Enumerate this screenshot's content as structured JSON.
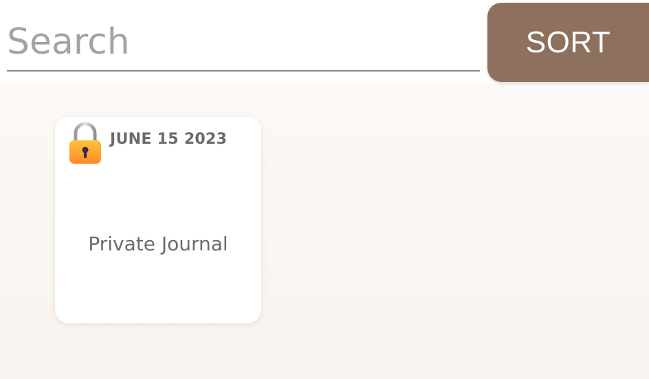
{
  "search": {
    "placeholder": "Search",
    "value": ""
  },
  "toolbar": {
    "sort_label": "SORT"
  },
  "colors": {
    "sort_button": "#8d705d",
    "card_background": "#ffffff",
    "page_background": "#f8f3ee"
  },
  "entries": [
    {
      "date": "JUNE 15 2023",
      "title": "Private Journal",
      "icon": "lock-icon",
      "locked": true
    }
  ]
}
